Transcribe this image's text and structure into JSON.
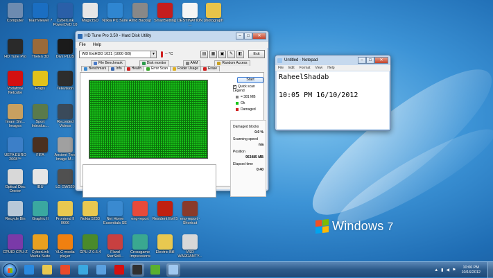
{
  "desktop": {
    "os_logo_text": "Windows",
    "os_logo_version": "7",
    "icons": [
      {
        "label": "Computer",
        "color": "#6d8bb0"
      },
      {
        "label": "TeamViewer 7",
        "color": "#1a6ec2"
      },
      {
        "label": "CyberLink PowerDVD 10",
        "color": "#2a5fa8"
      },
      {
        "label": "MagicISO",
        "color": "#e6e6e6"
      },
      {
        "label": "Nokia PC Suite",
        "color": "#2f86d1"
      },
      {
        "label": "Aimd Backup",
        "color": "#888"
      },
      {
        "label": "SmartSetting",
        "color": "#c41e1e"
      },
      {
        "label": "DESTINATION ...",
        "color": "#f5f5f5"
      },
      {
        "label": "photograph",
        "color": "#e8c44a"
      },
      {
        "label": "HD Tune Pro",
        "color": "#2a2a2a"
      },
      {
        "label": "TheEn 3D",
        "color": "#9a6a3a"
      },
      {
        "label": "Divx PLUS",
        "color": "#1b1b1b"
      },
      {
        "label": "Vodafone Netcube",
        "color": "#d41010"
      },
      {
        "label": "Fraps",
        "color": "#e2c21a"
      },
      {
        "label": "Television",
        "color": "#2d2d2d"
      },
      {
        "label": "Imam Shi... Images",
        "color": "#c8a060"
      },
      {
        "label": "Sport Introduc...",
        "color": "#5a7a4a"
      },
      {
        "label": "Recorded Videos",
        "color": "#3a4a5a"
      },
      {
        "label": "UEFA EURO 2008™",
        "color": "#3c7fc8"
      },
      {
        "label": "FIFA",
        "color": "#4a3020"
      },
      {
        "label": "Ancient Tree Image M...",
        "color": "#a0a0a0"
      },
      {
        "label": "Optical Disc Doctor",
        "color": "#d8d8d8"
      },
      {
        "label": "IBU",
        "color": "#e6e6e6"
      },
      {
        "label": "LG GW520",
        "color": "#505050"
      },
      {
        "label": "Recycle Bin",
        "color": "#b8c8d8"
      },
      {
        "label": "Graphic II",
        "color": "#3aa8a0"
      },
      {
        "label": "Frontend II 0606",
        "color": "#e8c850"
      },
      {
        "label": "Nokia 5233",
        "color": "#e8c850"
      },
      {
        "label": "Net Home Essentials SE",
        "color": "#3a8ad0"
      },
      {
        "label": "eng-report",
        "color": "#e84a3a"
      },
      {
        "label": "Resident Evil 5",
        "color": "#c02010"
      },
      {
        "label": "eng-report - Shortcut",
        "color": "#8a3a2a"
      },
      {
        "label": "CPUID CPU-Z",
        "color": "#7a3aa8"
      },
      {
        "label": "CyberLink Media Suite",
        "color": "#e8a020"
      },
      {
        "label": "VLC media player",
        "color": "#f08010"
      },
      {
        "label": "GPU-Z 0.6.4",
        "color": "#4a8a2a"
      },
      {
        "label": "Fland StarSkill...",
        "color": "#c84040"
      },
      {
        "label": "Crossgame Impressions",
        "color": "#3aa890"
      },
      {
        "label": "Electric Bill",
        "color": "#e8c850"
      },
      {
        "label": "VSO WARRANTY...",
        "color": "#d8d8d8"
      }
    ]
  },
  "hdtune": {
    "title": "HD Tune Pro 3.50 - Hard Disk Utility",
    "menu": [
      "File",
      "Help"
    ],
    "drive": "WD    ExtHDD 1021 (1000 GB)",
    "temperature": "-- °C",
    "exit_label": "Exit",
    "tabs_row1": [
      {
        "label": "File Benchmark",
        "color": "#4a7ac8"
      },
      {
        "label": "Disk monitor",
        "color": "#2a9a4a"
      },
      {
        "label": "AAM",
        "color": "#808080"
      },
      {
        "label": "Random Access",
        "color": "#c8a020"
      }
    ],
    "tabs_row2": [
      {
        "label": "Benchmark",
        "color": "#3a8ad0"
      },
      {
        "label": "Info",
        "color": "#3a6ab0"
      },
      {
        "label": "Health",
        "color": "#d02020"
      },
      {
        "label": "Error Scan",
        "color": "#3aa830"
      },
      {
        "label": "Folder Usage",
        "color": "#e0b020"
      },
      {
        "label": "Erase",
        "color": "#d02020"
      }
    ],
    "start_label": "Start",
    "quick_scan_label": "Quick scan",
    "legend_title": "Legend",
    "legend": [
      {
        "label": "= 381 MB",
        "color": "#808080"
      },
      {
        "label": "Ok",
        "color": "#19c419"
      },
      {
        "label": "Damaged",
        "color": "#d02020"
      }
    ],
    "stats": [
      {
        "label": "Damaged blocks",
        "value": "0.0 %"
      },
      {
        "label": "Scanning speed",
        "value": "n/a"
      },
      {
        "label": "Position",
        "value": "953485 MB"
      },
      {
        "label": "Elapsed time",
        "value": "0:40"
      }
    ]
  },
  "notepad": {
    "title": "Untitled - Notepad",
    "menu": [
      "File",
      "Edit",
      "Format",
      "View",
      "Help"
    ],
    "lines": [
      "RaheelShadab",
      "",
      "10:05 PM 16/10/2012"
    ]
  },
  "taskbar": {
    "pinned": [
      {
        "name": "ie",
        "color": "#2a8ae0"
      },
      {
        "name": "explorer",
        "color": "#e8c850"
      },
      {
        "name": "chrome",
        "color": "#e84a2a"
      },
      {
        "name": "media",
        "color": "#3aa8e0"
      },
      {
        "name": "network",
        "color": "#5aa0e0"
      },
      {
        "name": "vodafone",
        "color": "#d41010"
      },
      {
        "name": "hdtune",
        "color": "#303030"
      },
      {
        "name": "utorrent",
        "color": "#5ab030"
      },
      {
        "name": "notepad",
        "color": "#a0c8f0"
      }
    ],
    "clock_time": "10:06 PM",
    "clock_date": "10/16/2012"
  }
}
